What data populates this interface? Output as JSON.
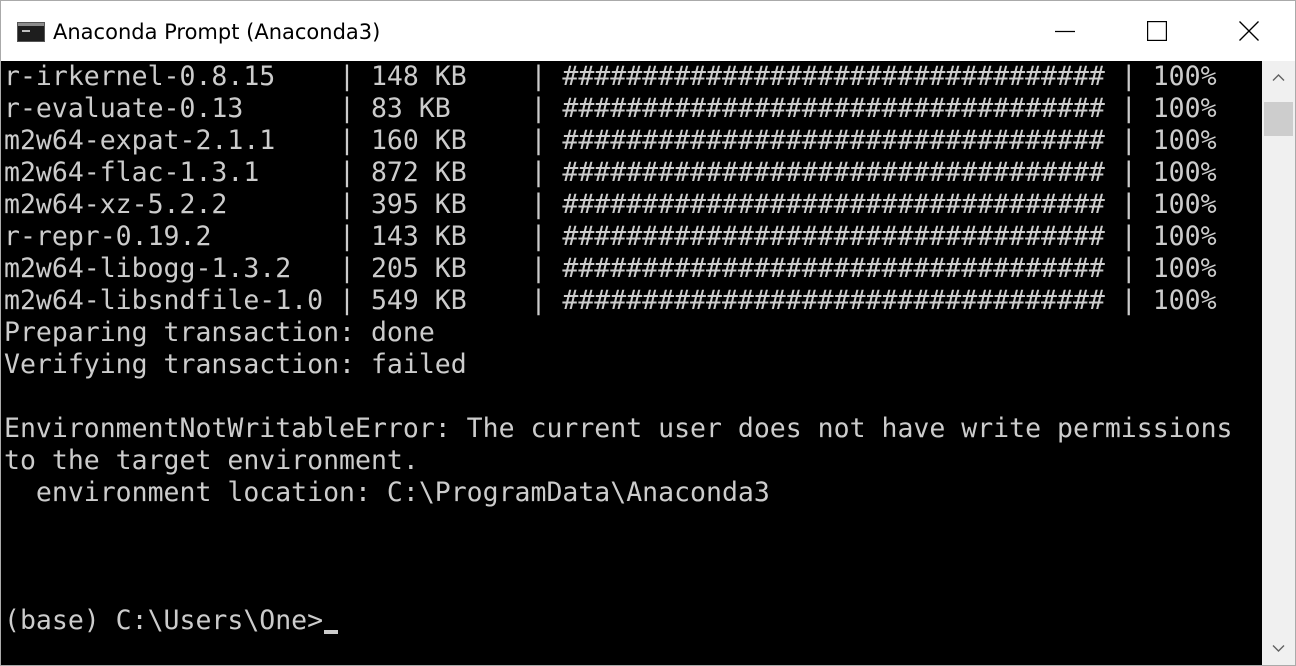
{
  "window": {
    "title": "Anaconda Prompt (Anaconda3)",
    "app_icon": "console-window-icon",
    "controls": {
      "minimize": "minimize-icon",
      "maximize": "maximize-icon",
      "close": "close-icon"
    }
  },
  "console": {
    "lines": [
      "r-irkernel-0.8.15    | 148 KB    | ################################## | 100%",
      "r-evaluate-0.13      | 83 KB     | ################################## | 100%",
      "m2w64-expat-2.1.1    | 160 KB    | ################################## | 100%",
      "m2w64-flac-1.3.1     | 872 KB    | ################################## | 100%",
      "m2w64-xz-5.2.2       | 395 KB    | ################################## | 100%",
      "r-repr-0.19.2        | 143 KB    | ################################## | 100%",
      "m2w64-libogg-1.3.2   | 205 KB    | ################################## | 100%",
      "m2w64-libsndfile-1.0 | 549 KB    | ################################## | 100%",
      "Preparing transaction: done",
      "Verifying transaction: failed",
      "",
      "EnvironmentNotWritableError: The current user does not have write permissions",
      "to the target environment.",
      "  environment location: C:\\ProgramData\\Anaconda3",
      "",
      "",
      "",
      "(base) C:\\Users\\One>"
    ]
  },
  "colors": {
    "console_background": "#000000",
    "console_text": "#cccccc",
    "titlebar_background": "#ffffff",
    "scrollbar_track": "#f0f0f0",
    "scrollbar_thumb": "#cdcdcd"
  }
}
